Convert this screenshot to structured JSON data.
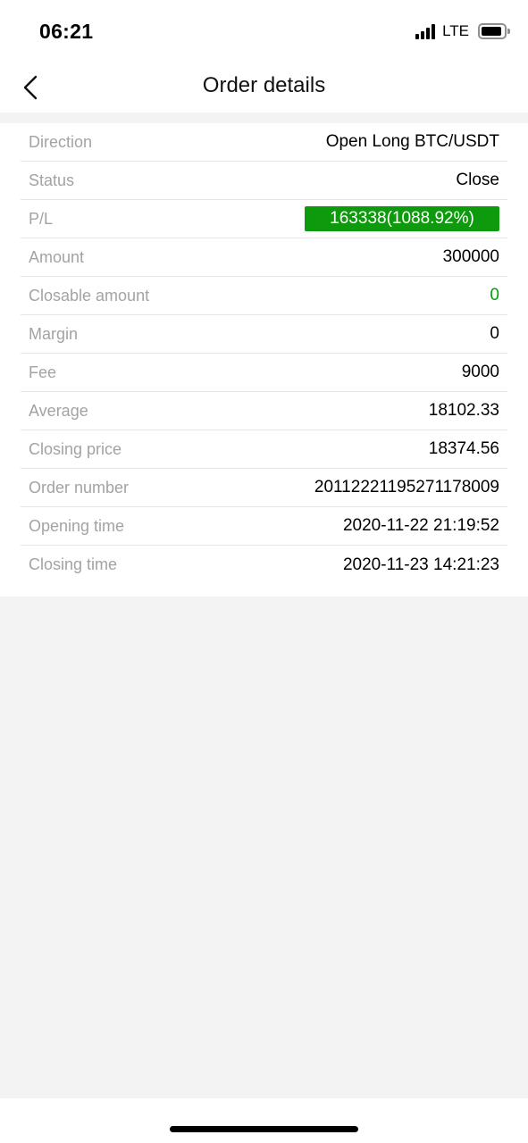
{
  "status_bar": {
    "time": "06:21",
    "network": "LTE",
    "icons": [
      "signal-icon",
      "battery-icon"
    ]
  },
  "header": {
    "title": "Order details",
    "back_icon": "chevron-left-icon"
  },
  "details": {
    "rows": [
      {
        "label": "Direction",
        "value": "Open Long BTC/USDT"
      },
      {
        "label": "Status",
        "value": "Close"
      },
      {
        "label": "P/L",
        "value": "163338(1088.92%)"
      },
      {
        "label": "Amount",
        "value": "300000"
      },
      {
        "label": "Closable amount",
        "value": "0"
      },
      {
        "label": "Margin",
        "value": "0"
      },
      {
        "label": "Fee",
        "value": "9000"
      },
      {
        "label": "Average",
        "value": "18102.33"
      },
      {
        "label": "Closing price",
        "value": "18374.56"
      },
      {
        "label": "Order number",
        "value": "20112221195271178009"
      },
      {
        "label": "Opening time",
        "value": "2020-11-22 21:19:52"
      },
      {
        "label": "Closing time",
        "value": "2020-11-23 14:21:23"
      }
    ]
  },
  "colors": {
    "profit_green": "#0d9a0d",
    "label_gray": "#a3a3a3",
    "background": "#f3f3f3"
  }
}
